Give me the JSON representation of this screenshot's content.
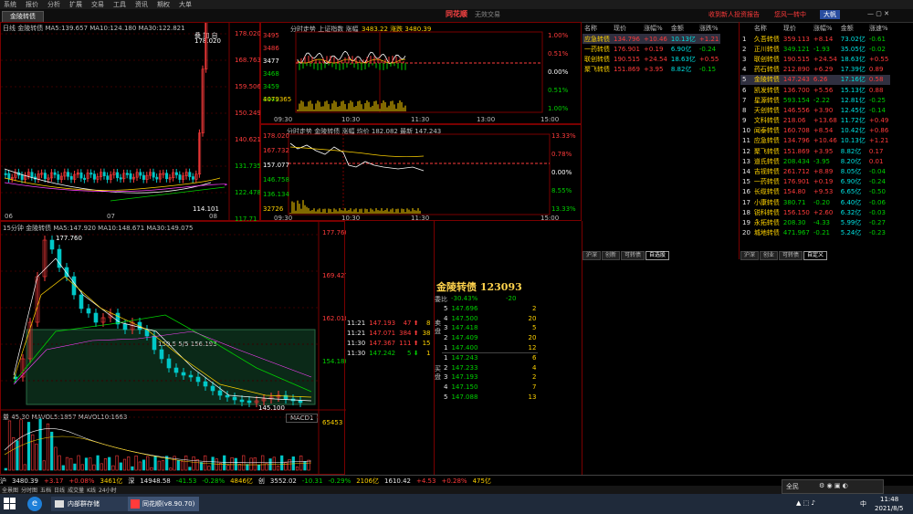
{
  "menu": [
    "系统",
    "报价",
    "分析",
    "扩展",
    "交易",
    "工具",
    "资讯",
    "期权",
    "大单"
  ],
  "tabs": {
    "active": "金陵转债",
    "second": "金陵转债"
  },
  "brand": {
    "name": "同花顺",
    "sub": "无效交易"
  },
  "top_right": {
    "a": "收到新人投资报告",
    "b": "您风一转中",
    "c": "大帆"
  },
  "left_chart": {
    "title": "日线 金陵转债 MA5:139.657 MA10:124.180 MA30:122.821",
    "y_labels": [
      "178.020",
      "168.763",
      "159.506",
      "150.249",
      "140.621",
      "131.735",
      "122.478",
      "117.71"
    ],
    "x_labels": [
      "06",
      "07",
      "08"
    ],
    "high_label": "178.020",
    "low_label": "114.101",
    "buttons": [
      "叠",
      "加",
      "自"
    ]
  },
  "index_chart": {
    "title": "分时走势 上证指数 涨幅",
    "values": "3483.22 涨跌 3480.39",
    "y_labels": [
      "3495",
      "3486",
      "3477",
      "3468",
      "3459",
      "3442"
    ],
    "pct_labels": [
      "1.00%",
      "0.51%",
      "0.00%",
      "0.51%",
      "1.00%"
    ],
    "vol_label": "4079365",
    "x_labels": [
      "09:30",
      "10:30",
      "11:30",
      "13:00",
      "15:00"
    ]
  },
  "bond_chart": {
    "title": "分时走势 金陵转债 涨幅 均价 182.082 最新 147.243",
    "y_labels": [
      "178.020",
      "167.732",
      "157.077",
      "146.758",
      "136.134",
      "32726"
    ],
    "pct_labels": [
      "13.33%",
      "0.78%",
      "0.00%",
      "8.55%",
      "13.33%"
    ],
    "x_labels": [
      "09:30",
      "10:30",
      "11:30",
      "15:00"
    ]
  },
  "main_chart": {
    "title": "15分钟 金陵转债 MA5:147.920 MA10:148.671 MA30:149.075",
    "y_labels": [
      "177.760",
      "169.427",
      "162.018",
      "154.180"
    ],
    "annot": "150.5 5/5 156.193",
    "high": "177.760",
    "low": "145.100",
    "vol_title": "量 45.30 MAVOL5:1857 MAVOL10:1663",
    "vol_label": "65453",
    "indicator": "MACD1"
  },
  "trades": [
    {
      "time": "11:21",
      "price": "147.193",
      "vol": "47",
      "dir": "up",
      "n": "8"
    },
    {
      "time": "11:21",
      "price": "147.071",
      "vol": "384",
      "dir": "up",
      "n": "38"
    },
    {
      "time": "11:30",
      "price": "147.367",
      "vol": "111",
      "dir": "up",
      "n": "15"
    },
    {
      "time": "11:30",
      "price": "147.242",
      "vol": "5",
      "dir": "down",
      "n": "1"
    }
  ],
  "orderbook": {
    "title": "金陵转债 123093",
    "ratio_label": "委比",
    "ratio_value": "-30.43%",
    "ratio_diff": "-20",
    "side_sell": "卖盘",
    "side_buy": "买盘",
    "rows": [
      {
        "lv": "5",
        "price": "147.696",
        "vol": "2"
      },
      {
        "lv": "4",
        "price": "147.500",
        "vol": "20"
      },
      {
        "lv": "3",
        "price": "147.418",
        "vol": "5"
      },
      {
        "lv": "2",
        "price": "147.409",
        "vol": "20"
      },
      {
        "lv": "1",
        "price": "147.400",
        "vol": "12"
      },
      {
        "lv": "1",
        "price": "147.243",
        "vol": "6"
      },
      {
        "lv": "2",
        "price": "147.233",
        "vol": "4"
      },
      {
        "lv": "3",
        "price": "147.193",
        "vol": "2"
      },
      {
        "lv": "4",
        "price": "147.150",
        "vol": "7"
      },
      {
        "lv": "5",
        "price": "147.088",
        "vol": "13"
      }
    ]
  },
  "watch_small": {
    "headers": [
      "名称",
      "现价",
      "涨幅%",
      "金额",
      "涨跌%"
    ],
    "rows": [
      {
        "name": "应急转债",
        "price": "134.796",
        "chg": "+10.46",
        "amt": "10.13亿",
        "pct": "+1.21"
      },
      {
        "name": "一药转债",
        "price": "176.901",
        "chg": "+0.19",
        "amt": "6.90亿",
        "pct": "-0.24"
      },
      {
        "name": "联创转债",
        "price": "190.515",
        "chg": "+24.54",
        "amt": "18.63亿",
        "pct": "+0.55"
      },
      {
        "name": "聚飞转债",
        "price": "151.869",
        "chg": "+3.95",
        "amt": "8.82亿",
        "pct": "-0.15"
      }
    ],
    "tabs": [
      "沪深",
      "创新",
      "可转债",
      "自选股"
    ]
  },
  "watch_list": {
    "headers": [
      "",
      "名称",
      "现价",
      "涨幅%",
      "金额",
      "涨速%"
    ],
    "rows": [
      {
        "i": "1",
        "name": "久吾转债",
        "price": "359.113",
        "chg": "+8.14",
        "amt": "73.02亿",
        "spd": "-0.61"
      },
      {
        "i": "2",
        "name": "正川转债",
        "price": "349.121",
        "chg": "-1.93",
        "amt": "35.05亿",
        "spd": "-0.02"
      },
      {
        "i": "3",
        "name": "联创转债",
        "price": "190.515",
        "chg": "+24.54",
        "amt": "18.63亿",
        "spd": "+0.55"
      },
      {
        "i": "4",
        "name": "药石转债",
        "price": "212.890",
        "chg": "+6.29",
        "amt": "17.39亿",
        "spd": "0.89"
      },
      {
        "i": "5",
        "name": "金陵转债",
        "price": "147.243",
        "chg": "6.26",
        "amt": "17.16亿",
        "spd": "0.58"
      },
      {
        "i": "6",
        "name": "凯发转债",
        "price": "136.700",
        "chg": "+5.56",
        "amt": "15.13亿",
        "spd": "0.88"
      },
      {
        "i": "7",
        "name": "星源转债",
        "price": "593.154",
        "chg": "-2.22",
        "amt": "12.81亿",
        "spd": "-0.25"
      },
      {
        "i": "8",
        "name": "天创转债",
        "price": "146.556",
        "chg": "+3.90",
        "amt": "12.45亿",
        "spd": "-0.14"
      },
      {
        "i": "9",
        "name": "文科转债",
        "price": "218.06",
        "chg": "+13.68",
        "amt": "11.72亿",
        "spd": "+0.49"
      },
      {
        "i": "10",
        "name": "闻泰转债",
        "price": "160.708",
        "chg": "+8.54",
        "amt": "10.42亿",
        "spd": "+0.86"
      },
      {
        "i": "11",
        "name": "应急转债",
        "price": "134.796",
        "chg": "+10.46",
        "amt": "10.13亿",
        "spd": "+1.21"
      },
      {
        "i": "12",
        "name": "聚飞转债",
        "price": "151.869",
        "chg": "+3.95",
        "amt": "8.82亿",
        "spd": "0.17"
      },
      {
        "i": "13",
        "name": "道氏转债",
        "price": "208.434",
        "chg": "-3.95",
        "amt": "8.20亿",
        "spd": "0.01"
      },
      {
        "i": "14",
        "name": "吉视转债",
        "price": "261.712",
        "chg": "+8.89",
        "amt": "8.05亿",
        "spd": "-0.04"
      },
      {
        "i": "15",
        "name": "一药转债",
        "price": "176.901",
        "chg": "+0.19",
        "amt": "6.90亿",
        "spd": "-0.24"
      },
      {
        "i": "16",
        "name": "长缆转债",
        "price": "154.80",
        "chg": "+9.53",
        "amt": "6.65亿",
        "spd": "-0.50"
      },
      {
        "i": "17",
        "name": "小康转债",
        "price": "380.71",
        "chg": "-0.20",
        "amt": "6.40亿",
        "spd": "-0.06"
      },
      {
        "i": "18",
        "name": "锐科转债",
        "price": "156.150",
        "chg": "+2.60",
        "amt": "6.32亿",
        "spd": "-0.03"
      },
      {
        "i": "19",
        "name": "永拓转债",
        "price": "208.30",
        "chg": "-4.33",
        "amt": "5.99亿",
        "spd": "-0.27"
      },
      {
        "i": "20",
        "name": "城地转债",
        "price": "471.967",
        "chg": "-0.21",
        "amt": "5.24亿",
        "spd": "-0.23"
      }
    ],
    "tabs": [
      "沪深",
      "创业",
      "可转债",
      "自定义"
    ]
  },
  "status": [
    {
      "t": "沪",
      "c": "white"
    },
    {
      "t": "3480.39",
      "c": "white"
    },
    {
      "t": "+3.17",
      "c": "red"
    },
    {
      "t": "+0.08%",
      "c": "red"
    },
    {
      "t": "3461亿",
      "c": "yel"
    },
    {
      "t": "深",
      "c": "white"
    },
    {
      "t": "14948.58",
      "c": "white"
    },
    {
      "t": "-41.53",
      "c": "green"
    },
    {
      "t": "-0.28%",
      "c": "green"
    },
    {
      "t": "4846亿",
      "c": "yel"
    },
    {
      "t": "创",
      "c": "white"
    },
    {
      "t": "3552.02",
      "c": "white"
    },
    {
      "t": "-10.31",
      "c": "green"
    },
    {
      "t": "-0.29%",
      "c": "green"
    },
    {
      "t": "2106亿",
      "c": "yel"
    },
    {
      "t": "1610.42",
      "c": "white"
    },
    {
      "t": "+4.53",
      "c": "red"
    },
    {
      "t": "+0.28%",
      "c": "red"
    },
    {
      "t": "475亿",
      "c": "yel"
    }
  ],
  "bottom_tabs": [
    "全景图",
    "分时图",
    "五档",
    "日线",
    "成交量",
    "K线",
    "24小时"
  ],
  "taskbar": {
    "items": [
      "内部群存储",
      "同花顺(v8.90.70)"
    ],
    "time": "11:48",
    "date": "2021/8/5",
    "ime": "中",
    "tray": "全民"
  },
  "colors": {
    "up": "#ff3b3b",
    "down": "#00d000",
    "frame": "#7a0000",
    "bg": "#000000"
  }
}
